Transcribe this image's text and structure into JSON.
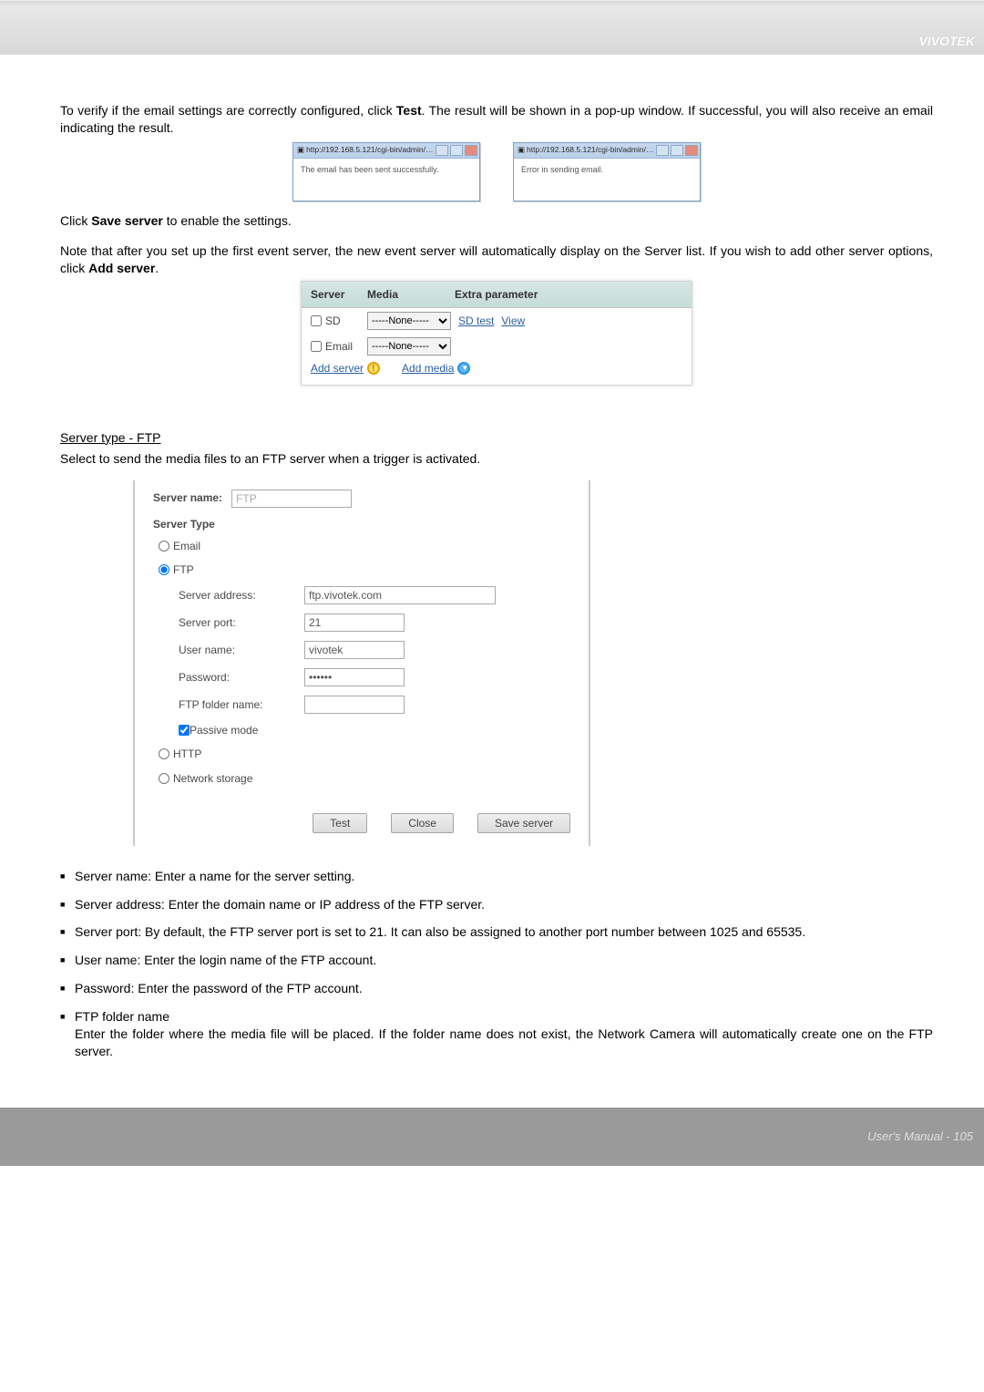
{
  "brand": "VIVOTEK",
  "p1a": "To verify if the email settings are correctly configured, click ",
  "p1b": "Test",
  "p1c": ". The result will be shown in a pop-up window. If successful, you will also receive an email indicating the result.",
  "popup1": {
    "title": "http://192.168.5.121/cgi-bin/admin/testserver.cgi - ...",
    "body": "The email has been sent successfully."
  },
  "popup2": {
    "title": "http://192.168.5.121/cgi-bin/admin/testserver.cgi - ...",
    "body": "Error in sending email."
  },
  "p2a": "Click ",
  "p2b": "Save server",
  "p2c": " to enable the settings.",
  "p3a": "Note that after you set up the first event server, the new event server will automatically display on the Server list.  If you wish to add other server options, click ",
  "p3b": "Add server",
  "p3c": ".",
  "table": {
    "h1": "Server",
    "h2": "Media",
    "h3": "Extra parameter",
    "rows": [
      {
        "label": "SD",
        "sel": "-----None-----",
        "links": [
          "SD test",
          "View"
        ]
      },
      {
        "label": "Email",
        "sel": "-----None-----",
        "links": []
      }
    ],
    "addserver": "Add server",
    "addmedia": "Add media"
  },
  "section": "Server type - FTP",
  "section_desc": "Select to send the media files to an FTP server when a trigger is activated.",
  "ftp": {
    "servername_label": "Server name:",
    "servername_value": "FTP",
    "type_label": "Server Type",
    "type_email": "Email",
    "type_ftp": "FTP",
    "type_http": "HTTP",
    "type_ns": "Network storage",
    "fields": {
      "addr_l": "Server address:",
      "addr_v": "ftp.vivotek.com",
      "port_l": "Server port:",
      "port_v": "21",
      "user_l": "User name:",
      "user_v": "vivotek",
      "pass_l": "Password:",
      "pass_v": "••••••",
      "fold_l": "FTP folder name:",
      "fold_v": "",
      "pm": "Passive mode"
    },
    "btn_test": "Test",
    "btn_close": "Close",
    "btn_save": "Save server"
  },
  "bullets": [
    "Server name: Enter a name for the server setting.",
    "Server address: Enter the domain name or IP address of the FTP server.",
    "Server port: By default, the FTP server port is set to 21. It can also be assigned to another port number between 1025 and 65535.",
    "User name: Enter the login name of the FTP account.",
    "Password: Enter the password of the FTP account.",
    "FTP folder name\nEnter the folder where the media file will be placed. If the folder name does not exist, the Network Camera will automatically create one on the FTP server."
  ],
  "footer": "User's Manual - 105"
}
